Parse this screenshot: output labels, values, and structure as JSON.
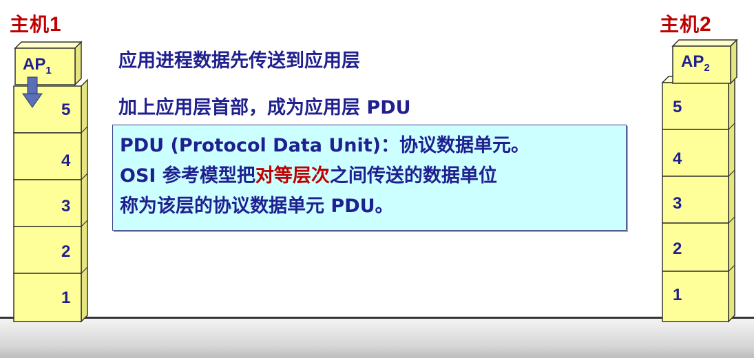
{
  "host1": {
    "title": "主机",
    "num": "1",
    "ap": "AP",
    "ap_sub": "1",
    "layers": [
      "5",
      "4",
      "3",
      "2",
      "1"
    ]
  },
  "host2": {
    "title": "主机",
    "num": "2",
    "ap": "AP",
    "ap_sub": "2",
    "layers": [
      "5",
      "4",
      "3",
      "2",
      "1"
    ]
  },
  "steps": {
    "line1": "应用进程数据先传送到应用层",
    "line2": "加上应用层首部，成为应用层 PDU"
  },
  "note": {
    "line1": "PDU (Protocol Data Unit)：协议数据单元。",
    "line2_a": "OSI 参考模型把",
    "line2_hl": "对等层次",
    "line2_b": "之间传送的数据单位",
    "line3": "称为该层的协议数据单元 PDU。"
  },
  "colors": {
    "box_fill": "#ffff99",
    "box_top": "#ffffcc",
    "box_side": "#e6e680",
    "text": "#1f1f8f",
    "highlight": "#c00000",
    "note_bg": "#ccffff"
  }
}
